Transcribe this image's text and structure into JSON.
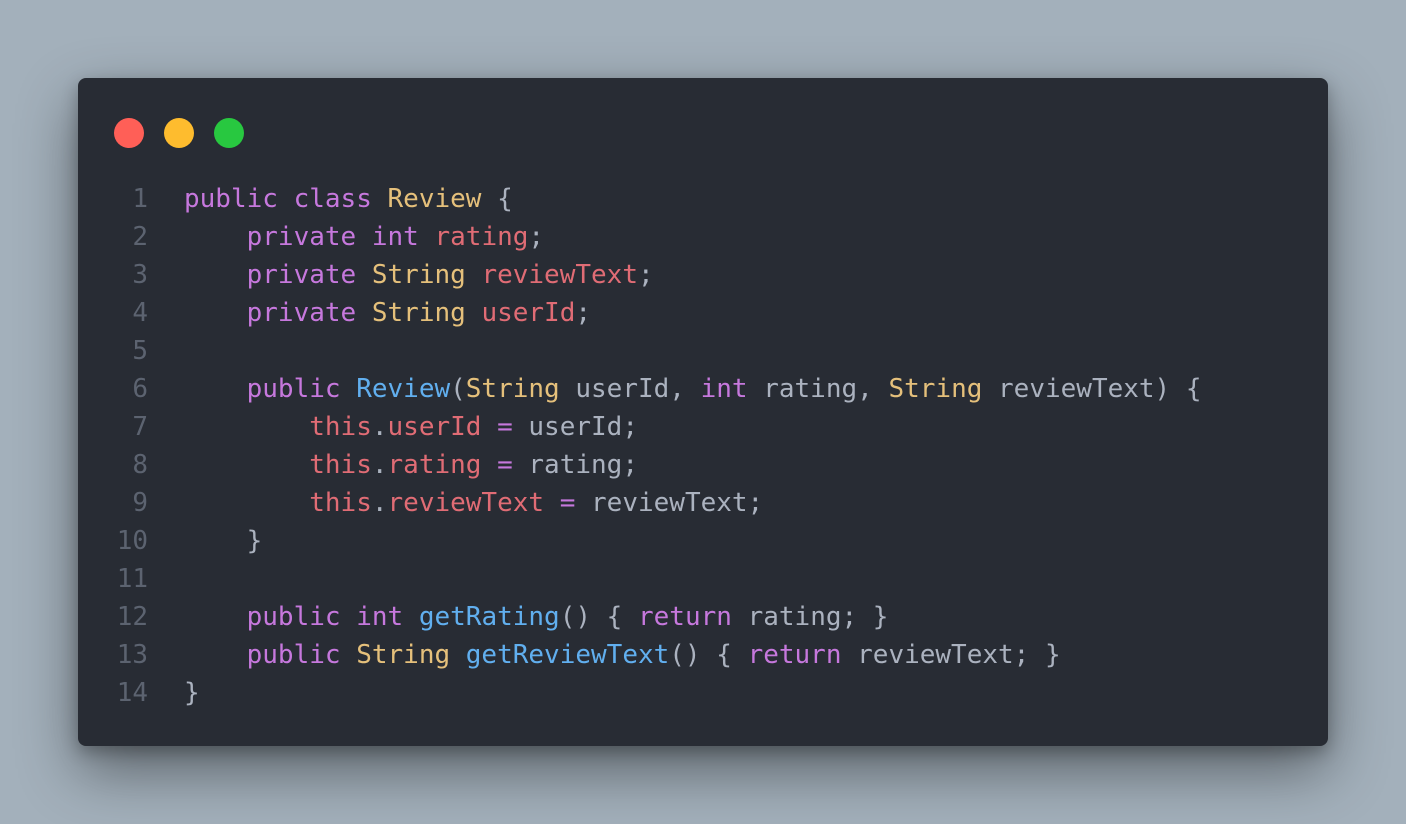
{
  "window": {
    "dots": [
      {
        "name": "close",
        "color": "#ff5f57"
      },
      {
        "name": "minimize",
        "color": "#febc2e"
      },
      {
        "name": "maximize",
        "color": "#28c840"
      }
    ]
  },
  "theme": {
    "keyword": "#c678dd",
    "type": "#e5c07b",
    "field": "#e06c75",
    "function": "#61afef",
    "plain": "#abb2bf",
    "line_number": "#5c6370",
    "background": "#282c34"
  },
  "code": {
    "language": "java",
    "lines": [
      {
        "number": "1",
        "tokens": [
          {
            "t": "kw",
            "v": "public"
          },
          {
            "t": "p",
            "v": " "
          },
          {
            "t": "kw",
            "v": "class"
          },
          {
            "t": "p",
            "v": " "
          },
          {
            "t": "ty",
            "v": "Review"
          },
          {
            "t": "p",
            "v": " {"
          }
        ]
      },
      {
        "number": "2",
        "tokens": [
          {
            "t": "p",
            "v": "    "
          },
          {
            "t": "kw",
            "v": "private"
          },
          {
            "t": "p",
            "v": " "
          },
          {
            "t": "kw",
            "v": "int"
          },
          {
            "t": "p",
            "v": " "
          },
          {
            "t": "fd",
            "v": "rating"
          },
          {
            "t": "p",
            "v": ";"
          }
        ]
      },
      {
        "number": "3",
        "tokens": [
          {
            "t": "p",
            "v": "    "
          },
          {
            "t": "kw",
            "v": "private"
          },
          {
            "t": "p",
            "v": " "
          },
          {
            "t": "ty",
            "v": "String"
          },
          {
            "t": "p",
            "v": " "
          },
          {
            "t": "fd",
            "v": "reviewText"
          },
          {
            "t": "p",
            "v": ";"
          }
        ]
      },
      {
        "number": "4",
        "tokens": [
          {
            "t": "p",
            "v": "    "
          },
          {
            "t": "kw",
            "v": "private"
          },
          {
            "t": "p",
            "v": " "
          },
          {
            "t": "ty",
            "v": "String"
          },
          {
            "t": "p",
            "v": " "
          },
          {
            "t": "fd",
            "v": "userId"
          },
          {
            "t": "p",
            "v": ";"
          }
        ]
      },
      {
        "number": "5",
        "tokens": []
      },
      {
        "number": "6",
        "tokens": [
          {
            "t": "p",
            "v": "    "
          },
          {
            "t": "kw",
            "v": "public"
          },
          {
            "t": "p",
            "v": " "
          },
          {
            "t": "fn",
            "v": "Review"
          },
          {
            "t": "p",
            "v": "("
          },
          {
            "t": "ty",
            "v": "String"
          },
          {
            "t": "p",
            "v": " userId, "
          },
          {
            "t": "kw",
            "v": "int"
          },
          {
            "t": "p",
            "v": " rating, "
          },
          {
            "t": "ty",
            "v": "String"
          },
          {
            "t": "p",
            "v": " reviewText) {"
          }
        ]
      },
      {
        "number": "7",
        "tokens": [
          {
            "t": "p",
            "v": "        "
          },
          {
            "t": "fd",
            "v": "this"
          },
          {
            "t": "p",
            "v": "."
          },
          {
            "t": "fd",
            "v": "userId"
          },
          {
            "t": "p",
            "v": " "
          },
          {
            "t": "kw",
            "v": "="
          },
          {
            "t": "p",
            "v": " userId;"
          }
        ]
      },
      {
        "number": "8",
        "tokens": [
          {
            "t": "p",
            "v": "        "
          },
          {
            "t": "fd",
            "v": "this"
          },
          {
            "t": "p",
            "v": "."
          },
          {
            "t": "fd",
            "v": "rating"
          },
          {
            "t": "p",
            "v": " "
          },
          {
            "t": "kw",
            "v": "="
          },
          {
            "t": "p",
            "v": " rating;"
          }
        ]
      },
      {
        "number": "9",
        "tokens": [
          {
            "t": "p",
            "v": "        "
          },
          {
            "t": "fd",
            "v": "this"
          },
          {
            "t": "p",
            "v": "."
          },
          {
            "t": "fd",
            "v": "reviewText"
          },
          {
            "t": "p",
            "v": " "
          },
          {
            "t": "kw",
            "v": "="
          },
          {
            "t": "p",
            "v": " reviewText;"
          }
        ]
      },
      {
        "number": "10",
        "tokens": [
          {
            "t": "p",
            "v": "    }"
          }
        ]
      },
      {
        "number": "11",
        "tokens": []
      },
      {
        "number": "12",
        "tokens": [
          {
            "t": "p",
            "v": "    "
          },
          {
            "t": "kw",
            "v": "public"
          },
          {
            "t": "p",
            "v": " "
          },
          {
            "t": "kw",
            "v": "int"
          },
          {
            "t": "p",
            "v": " "
          },
          {
            "t": "fn",
            "v": "getRating"
          },
          {
            "t": "p",
            "v": "() { "
          },
          {
            "t": "kw",
            "v": "return"
          },
          {
            "t": "p",
            "v": " rating; }"
          }
        ]
      },
      {
        "number": "13",
        "tokens": [
          {
            "t": "p",
            "v": "    "
          },
          {
            "t": "kw",
            "v": "public"
          },
          {
            "t": "p",
            "v": " "
          },
          {
            "t": "ty",
            "v": "String"
          },
          {
            "t": "p",
            "v": " "
          },
          {
            "t": "fn",
            "v": "getReviewText"
          },
          {
            "t": "p",
            "v": "() { "
          },
          {
            "t": "kw",
            "v": "return"
          },
          {
            "t": "p",
            "v": " reviewText; }"
          }
        ]
      },
      {
        "number": "14",
        "tokens": [
          {
            "t": "p",
            "v": "}"
          }
        ]
      }
    ]
  }
}
